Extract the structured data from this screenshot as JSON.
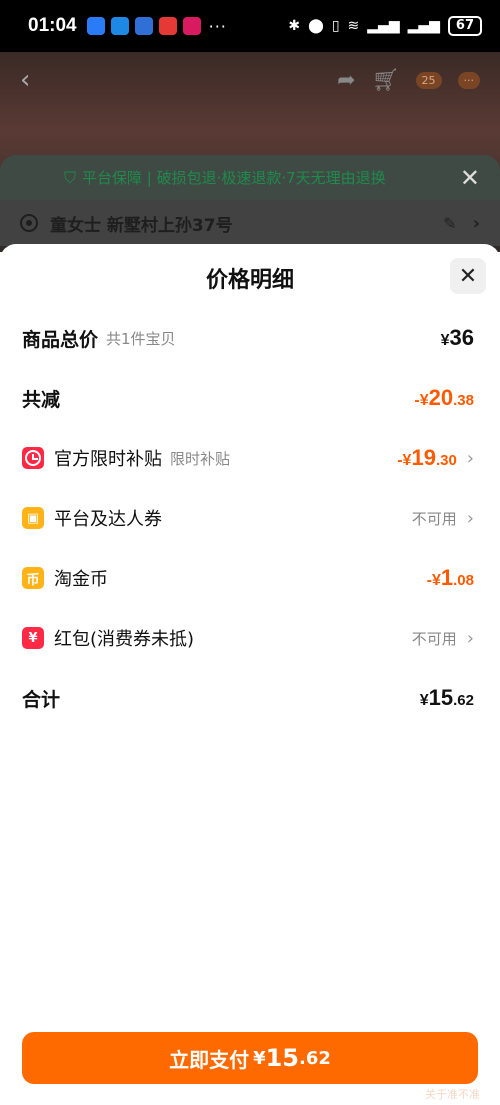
{
  "status_bar": {
    "time": "01:04",
    "more": "···",
    "battery": "67",
    "app_icon_colors": [
      "#2a7cf6",
      "#1e88e5",
      "#2f6fd6",
      "#e53935",
      "#d81b60"
    ]
  },
  "background": {
    "cart_badge": "25",
    "guarantee_text": "平台保障 | 破损包退·极速退款·7天无理由退换",
    "address": "童女士 新墅村上孙37号"
  },
  "sheet": {
    "title": "价格明细",
    "close_label": "✕"
  },
  "rows": {
    "total": {
      "label": "商品总价",
      "sub": "共1件宝贝",
      "currency": "¥",
      "int": "36",
      "dec": ""
    },
    "discount": {
      "label": "共减",
      "prefix": "-¥",
      "int": "20",
      "dec": ".38"
    },
    "subsidy": {
      "label": "官方限时补贴",
      "sub": "限时补贴",
      "prefix": "-¥",
      "int": "19",
      "dec": ".30"
    },
    "coupon": {
      "label": "平台及达人券",
      "status": "不可用"
    },
    "coins": {
      "label": "淘金币",
      "prefix": "-¥",
      "int": "1",
      "dec": ".08"
    },
    "redpacket": {
      "label": "红包(消费券未抵)",
      "status": "不可用"
    },
    "sum": {
      "label": "合计",
      "currency": "¥",
      "int": "15",
      "dec": ".62"
    }
  },
  "pay_button": {
    "label": "立即支付",
    "currency": "¥",
    "int": "15",
    "dec": ".62"
  },
  "watermark": "关于准不准",
  "colors": {
    "accent": "#ff6a00",
    "discount": "#ff5a00",
    "icon_red": "#ff2946",
    "icon_yellow": "#ffb317"
  }
}
